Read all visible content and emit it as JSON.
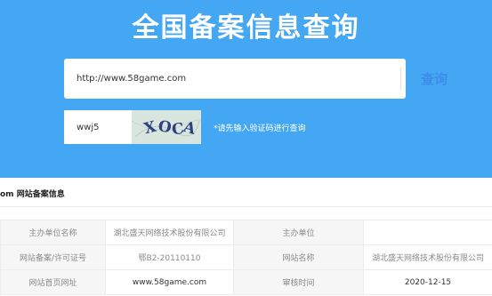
{
  "hero": {
    "title": "全国备案信息查询",
    "background": "#44a7f4"
  },
  "search": {
    "value": "http://www.58game.com",
    "button_label": "查询",
    "button_color": "#3d8ee8"
  },
  "captcha": {
    "value": "wwj5",
    "image_text": "XOCA",
    "hint": "*请先输入验证码进行查询"
  },
  "record": {
    "section_title": "om 网站备案信息",
    "rows": [
      {
        "label_1": "主办单位名称",
        "value_1": "湖北盛天网络技术股份有限公司",
        "label_2": "主办单位",
        "value_2": ""
      },
      {
        "label_1": "网站备案/许可证号",
        "value_1": "鄂B2-20110110",
        "label_2": "网站名称",
        "value_2": "湖北盛天网络技术股份有限公司"
      },
      {
        "label_1": "网站首页网址",
        "value_1": "www.58game.com",
        "label_2": "审核时间",
        "value_2": "2020-12-15"
      }
    ]
  }
}
